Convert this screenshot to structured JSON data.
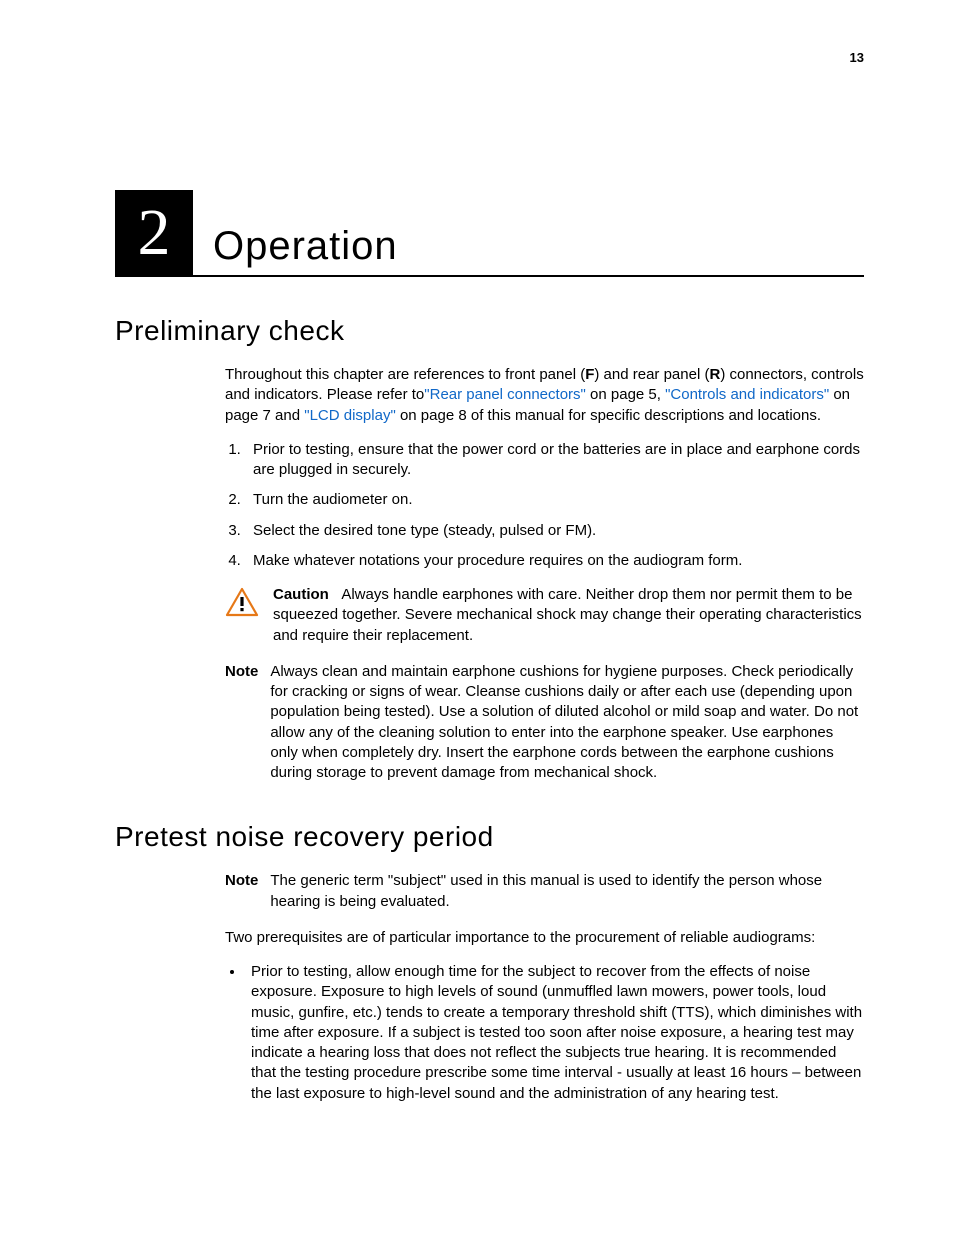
{
  "page_number": "13",
  "chapter": {
    "number": "2",
    "title": "Operation"
  },
  "section1": {
    "title": "Preliminary check",
    "intro_1": "Throughout this chapter are references to front panel (",
    "intro_F": "F",
    "intro_2": ") and rear panel (",
    "intro_R": "R",
    "intro_3": ") connectors, controls and indicators. Please refer to",
    "link1": "\"Rear panel connectors\"",
    "intro_4": " on page 5, ",
    "link2": "\"Controls and indicators\"",
    "intro_5": " on page 7 and ",
    "link3": "\"LCD display\"",
    "intro_6": " on page 8 of this manual for specific descriptions and locations.",
    "steps": [
      "Prior to testing, ensure that the power cord or the batteries are in place and earphone cords are plugged in securely.",
      "Turn the audiometer on.",
      "Select the desired tone type (steady, pulsed or FM).",
      "Make whatever notations your procedure requires on the audiogram form."
    ],
    "caution_label": "Caution",
    "caution_text": "Always handle earphones with care. Neither drop them nor permit them to be squeezed together. Severe mechanical shock may change their operating characteristics and require their replacement.",
    "note_label": "Note",
    "note_text": "Always clean and maintain earphone cushions for hygiene purposes. Check periodically for cracking or signs of wear. Cleanse cushions daily or after each use (depending upon population being tested). Use a solution of diluted alcohol or mild soap and water. Do not allow any of the cleaning solution to enter into the earphone speaker. Use earphones only when completely dry. Insert the earphone cords between the earphone cushions during storage to prevent damage from mechanical shock."
  },
  "section2": {
    "title": "Pretest noise recovery period",
    "note_label": "Note",
    "note_text": "The generic term \"subject\" used in this manual is used to identify the person whose hearing is being evaluated.",
    "para": "Two prerequisites are of particular importance to the procurement of reliable audiograms:",
    "bullet": "Prior to testing, allow enough time for the subject to recover from the effects of noise exposure. Exposure to high levels of sound (unmuffled lawn mowers, power tools, loud music, gunfire, etc.) tends to create a temporary threshold shift (TTS), which diminishes with time after exposure. If a subject is tested too soon after noise exposure, a hearing test may indicate a hearing loss that does not reflect the subjects true hearing. It is recommended that the testing procedure prescribe some time interval - usually at least 16 hours – between the last exposure to high-level sound and the administration of any hearing test."
  }
}
